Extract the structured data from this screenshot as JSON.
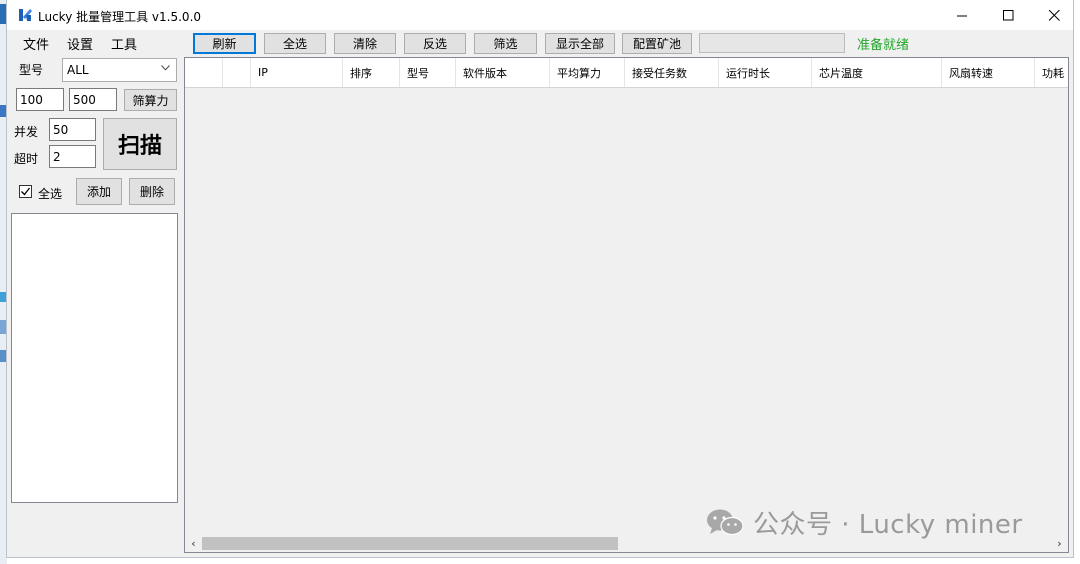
{
  "window": {
    "title": "Lucky 批量管理工具 v1.5.0.0",
    "controls": {
      "minimize": "—",
      "maximize": "☐",
      "close": "✕"
    }
  },
  "menu": [
    "文件",
    "设置",
    "工具"
  ],
  "toolbar": {
    "buttons": [
      "刷新",
      "全选",
      "清除",
      "反选",
      "筛选",
      "显示全部",
      "配置矿池"
    ],
    "progress_percent": 0,
    "status": "准备就绪",
    "status_color": "#22a62a"
  },
  "left_panel": {
    "model_label": "型号",
    "model_value": "ALL",
    "range_from": "100",
    "range_to": "500",
    "filter_hash_button": "筛算力",
    "concurrency_label": "并发",
    "concurrency_value": "50",
    "timeout_label": "超时",
    "timeout_value": "2",
    "scan_button": "扫描",
    "select_all_label": "全选",
    "select_all_checked": true,
    "add_button": "添加",
    "delete_button": "删除"
  },
  "table": {
    "columns": [
      "",
      "",
      "IP",
      "排序",
      "型号",
      "软件版本",
      "平均算力",
      "接受任务数",
      "运行时长",
      "芯片温度",
      "风扇转速",
      "功耗"
    ],
    "rows": []
  },
  "watermark": "公众号 · Lucky miner"
}
